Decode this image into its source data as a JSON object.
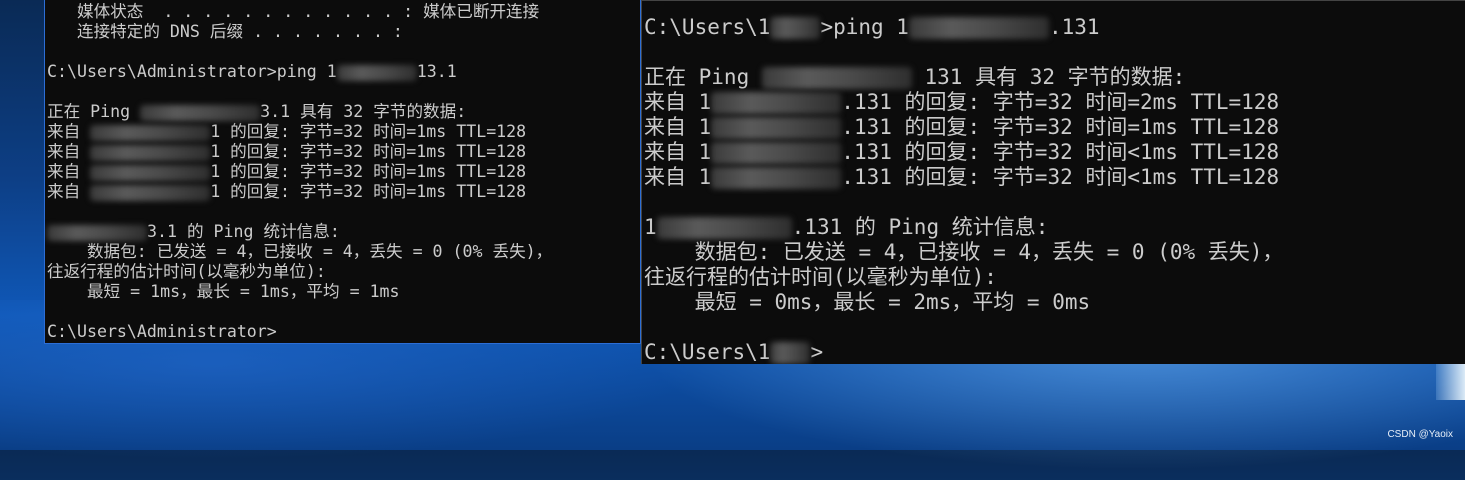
{
  "desktop": {
    "watermark": "CSDN @Yaoix"
  },
  "left_console": {
    "lines": [
      {
        "pre": "   媒体状态  . . . . . . . . . . . . : 媒体已断开连接",
        "mid": "",
        "post": ""
      },
      {
        "pre": "   连接特定的 DNS 后缀 . . . . . . . :",
        "mid": "",
        "post": ""
      },
      {
        "pre": "",
        "mid": "",
        "post": ""
      },
      {
        "pre": "C:\\Users\\Administrator>ping 1",
        "mid": "blur",
        "post": "13.1"
      },
      {
        "pre": "",
        "mid": "",
        "post": ""
      },
      {
        "pre": "正在 Ping ",
        "mid": "blur",
        "post": "3.1 具有 32 字节的数据:"
      },
      {
        "pre": "来自 ",
        "mid": "blur",
        "post": "1 的回复: 字节=32 时间=1ms TTL=128"
      },
      {
        "pre": "来自 ",
        "mid": "blur",
        "post": "1 的回复: 字节=32 时间=1ms TTL=128"
      },
      {
        "pre": "来自 ",
        "mid": "blur",
        "post": "1 的回复: 字节=32 时间=1ms TTL=128"
      },
      {
        "pre": "来自 ",
        "mid": "blur",
        "post": "1 的回复: 字节=32 时间=1ms TTL=128"
      },
      {
        "pre": "",
        "mid": "",
        "post": ""
      },
      {
        "pre": "",
        "mid": "blur",
        "post": "3.1 的 Ping 统计信息:"
      },
      {
        "pre": "    数据包: 已发送 = 4，已接收 = 4，丢失 = 0 (0% 丢失)，",
        "mid": "",
        "post": ""
      },
      {
        "pre": "往返行程的估计时间(以毫秒为单位):",
        "mid": "",
        "post": ""
      },
      {
        "pre": "    最短 = 1ms，最长 = 1ms，平均 = 1ms",
        "mid": "",
        "post": ""
      },
      {
        "pre": "",
        "mid": "",
        "post": ""
      },
      {
        "pre": "C:\\Users\\Administrator>",
        "mid": "",
        "post": ""
      }
    ]
  },
  "right_console": {
    "lines": [
      {
        "pre": "C:\\Users\\1",
        "mid": "blur",
        "post": ">ping 1",
        "mid2": "blur",
        "post2": ".131"
      },
      {
        "pre": "",
        "mid": "",
        "post": ""
      },
      {
        "pre": "正在 Ping ",
        "mid": "blur",
        "post": " 131 具有 32 字节的数据:"
      },
      {
        "pre": "来自 1",
        "mid": "blur",
        "post": ".131 的回复: 字节=32 时间=2ms TTL=128"
      },
      {
        "pre": "来自 1",
        "mid": "blur",
        "post": ".131 的回复: 字节=32 时间=1ms TTL=128"
      },
      {
        "pre": "来自 1",
        "mid": "blur",
        "post": ".131 的回复: 字节=32 时间<1ms TTL=128"
      },
      {
        "pre": "来自 1",
        "mid": "blur",
        "post": ".131 的回复: 字节=32 时间<1ms TTL=128"
      },
      {
        "pre": "",
        "mid": "",
        "post": ""
      },
      {
        "pre": "1",
        "mid": "blur",
        "post": ".131 的 Ping 统计信息:"
      },
      {
        "pre": "    数据包: 已发送 = 4，已接收 = 4，丢失 = 0 (0% 丢失)，",
        "mid": "",
        "post": ""
      },
      {
        "pre": "往返行程的估计时间(以毫秒为单位):",
        "mid": "",
        "post": ""
      },
      {
        "pre": "    最短 = 0ms，最长 = 2ms，平均 = 0ms",
        "mid": "",
        "post": ""
      },
      {
        "pre": "",
        "mid": "",
        "post": ""
      },
      {
        "pre": "C:\\Users\\1",
        "mid": "blur",
        "post": ">"
      }
    ]
  }
}
